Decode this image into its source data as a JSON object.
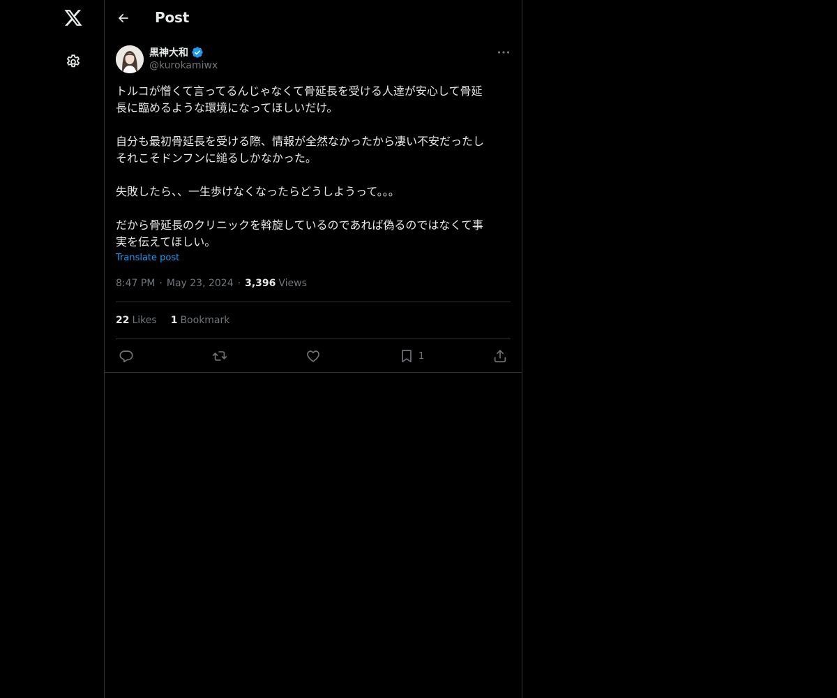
{
  "header": {
    "title": "Post"
  },
  "author": {
    "display_name": "黒神大和",
    "handle": "@kurokamiwx",
    "verified": true,
    "verified_color": "#1d9bf0"
  },
  "tweet": {
    "text": "トルコが憎くて言ってるんじゃなくて骨延長を受ける人達が安心して骨延\n長に臨めるような環境になってほしいだけ。\n\n自分も最初骨延長を受ける際、情報が全然なかったから凄い不安だったし\nそれこそドンフンに縋るしかなかった。\n\n失敗したら、、一生歩けなくなったらどうしようって。。。\n\nだから骨延長のクリニックを斡旋しているのであれば偽るのではなくて事\n実を伝えてほしい。",
    "translate_label": "Translate post",
    "time": "8:47 PM",
    "date": "May 23, 2024",
    "views_count": "3,396",
    "views_label": "Views"
  },
  "stats": {
    "likes_count": "22",
    "likes_label": "Likes",
    "bookmarks_count": "1",
    "bookmarks_label": "Bookmark"
  },
  "actions": {
    "bookmark_count": "1"
  },
  "icons": {
    "nav_logo": "x-logo-icon",
    "nav_settings": "gear-icon",
    "back": "arrow-left-icon",
    "more": "more-horizontal-icon",
    "reply": "reply-icon",
    "repost": "repost-icon",
    "like": "heart-icon",
    "bookmark": "bookmark-icon",
    "share": "share-icon"
  },
  "colors": {
    "background": "#000000",
    "text": "#e7e9ea",
    "muted": "#71767b",
    "accent": "#1d9bf0",
    "border": "#2f3336"
  }
}
